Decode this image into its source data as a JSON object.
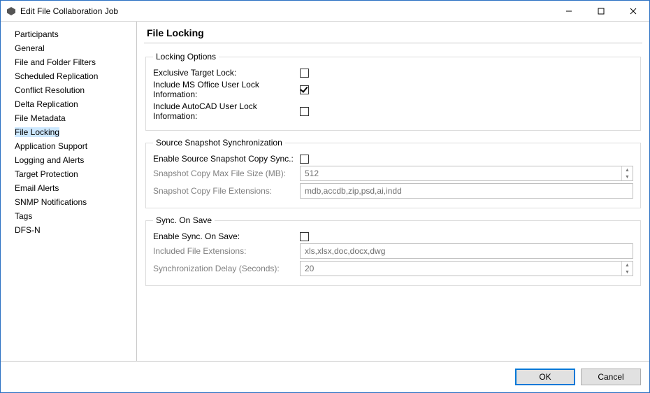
{
  "window": {
    "title": "Edit File Collaboration Job"
  },
  "sidebar": {
    "items": [
      {
        "label": "Participants"
      },
      {
        "label": "General"
      },
      {
        "label": "File and Folder Filters"
      },
      {
        "label": "Scheduled Replication"
      },
      {
        "label": "Conflict Resolution"
      },
      {
        "label": "Delta Replication"
      },
      {
        "label": "File Metadata"
      },
      {
        "label": "File Locking",
        "selected": true
      },
      {
        "label": "Application Support"
      },
      {
        "label": "Logging and Alerts"
      },
      {
        "label": "Target Protection"
      },
      {
        "label": "Email Alerts"
      },
      {
        "label": "SNMP Notifications"
      },
      {
        "label": "Tags"
      },
      {
        "label": "DFS-N"
      }
    ]
  },
  "page": {
    "title": "File Locking"
  },
  "locking": {
    "legend": "Locking Options",
    "exclusive_label": "Exclusive Target Lock:",
    "exclusive_checked": false,
    "msoffice_label": "Include MS Office User Lock Information:",
    "msoffice_checked": true,
    "autocad_label": "Include AutoCAD User Lock Information:",
    "autocad_checked": false
  },
  "snapshot": {
    "legend": "Source Snapshot Synchronization",
    "enable_label": "Enable Source Snapshot Copy Sync.:",
    "enable_checked": false,
    "maxsize_label": "Snapshot Copy Max File Size (MB):",
    "maxsize_value": "512",
    "ext_label": "Snapshot Copy File Extensions:",
    "ext_value": "mdb,accdb,zip,psd,ai,indd"
  },
  "syncsave": {
    "legend": "Sync. On Save",
    "enable_label": "Enable Sync. On Save:",
    "enable_checked": false,
    "included_label": "Included File Extensions:",
    "included_value": "xls,xlsx,doc,docx,dwg",
    "delay_label": "Synchronization Delay (Seconds):",
    "delay_value": "20"
  },
  "buttons": {
    "ok": "OK",
    "cancel": "Cancel"
  }
}
